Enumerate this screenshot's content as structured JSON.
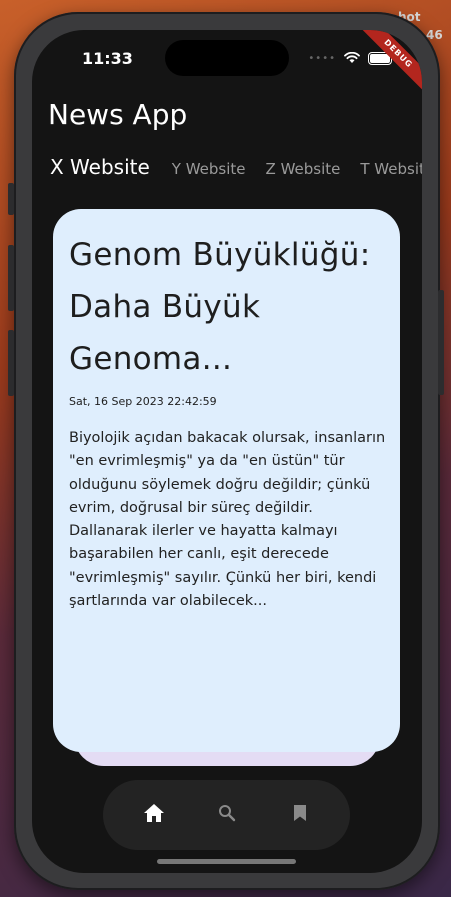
{
  "status_bar": {
    "time": "11:33"
  },
  "debug_banner": "DEBUG",
  "bg_text": {
    "top": "hot",
    "bottom": "46"
  },
  "app": {
    "title": "News App"
  },
  "tabs": [
    {
      "label": "X Website",
      "active": true
    },
    {
      "label": "Y Website",
      "active": false
    },
    {
      "label": "Z Website",
      "active": false
    },
    {
      "label": "T Website",
      "active": false
    }
  ],
  "article": {
    "title": " Genom Büyüklüğü: Daha Büyük Genoma...",
    "date": "Sat, 16 Sep 2023 22:42:59",
    "body": " Biyolojik açıdan bakacak olursak, insanların \"en evrimleşmiş\" ya da \"en üstün\" tür olduğunu söylemek doğru değildir; çünkü evrim, doğrusal bir süreç değildir. Dallanarak ilerler ve hayatta kalmayı başarabilen her canlı, eşit derecede \"evrimleşmiş\" sayılır. Çünkü her biri, kendi şartlarında var olabilecek..."
  },
  "bottom_nav": [
    {
      "icon": "home-icon",
      "active": true
    },
    {
      "icon": "search-icon",
      "active": false
    },
    {
      "icon": "bookmark-icon",
      "active": false
    }
  ]
}
